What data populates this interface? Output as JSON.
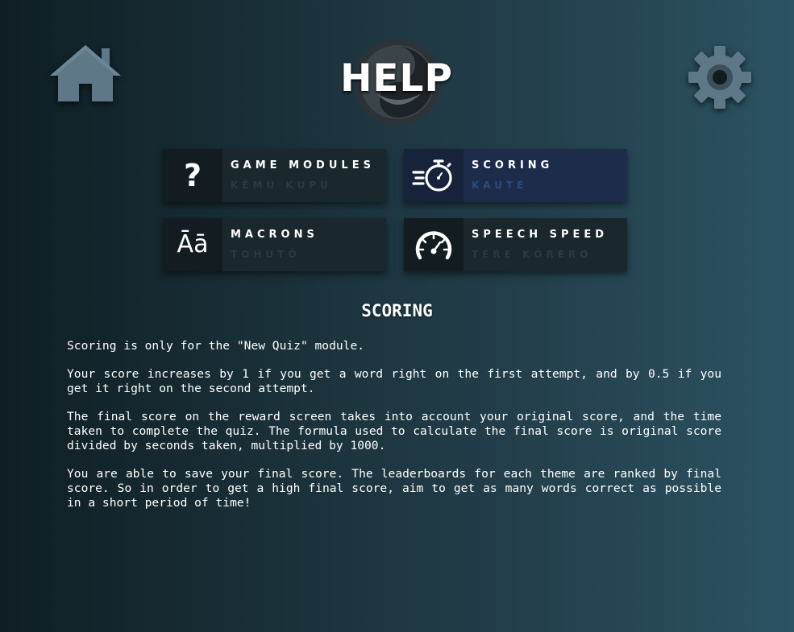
{
  "header": {
    "title": "HELP"
  },
  "tiles": [
    {
      "title": "GAME MODULES",
      "subtitle": "KĒMU KUPU",
      "icon": "question-mark-icon",
      "icon_text": "?"
    },
    {
      "title": "SCORING",
      "subtitle": "KAUTE",
      "icon": "stopwatch-icon",
      "active": true
    },
    {
      "title": "MACRONS",
      "subtitle": "TOHUTŌ",
      "icon": "macron-text-icon",
      "icon_text": "Āā"
    },
    {
      "title": "SPEECH SPEED",
      "subtitle": "TERE KŌRERO",
      "icon": "speedometer-icon"
    }
  ],
  "section": {
    "heading": "SCORING",
    "paragraphs": [
      "Scoring is only for the \"New Quiz\" module.",
      "Your score increases by 1 if you get a word right on the first attempt, and by 0.5 if you get it right on the second attempt.",
      "The final score on the reward screen takes into account your original score, and the time taken to complete the quiz. The formula used to calculate the final score is original score divided by seconds taken, multiplied by 1000.",
      "You are able to save your final score. The leaderboards for each theme are ranked by final score. So in order to get a high final score, aim to get as many words correct as possible in a short period of time!"
    ]
  },
  "colors": {
    "icon_gray": "#5f7887",
    "tile_bg": "#1a272d",
    "tile_active_bg": "#1c2c4a",
    "subtitle_dim": "#2a3a41",
    "subtitle_active": "#2c4a80"
  }
}
